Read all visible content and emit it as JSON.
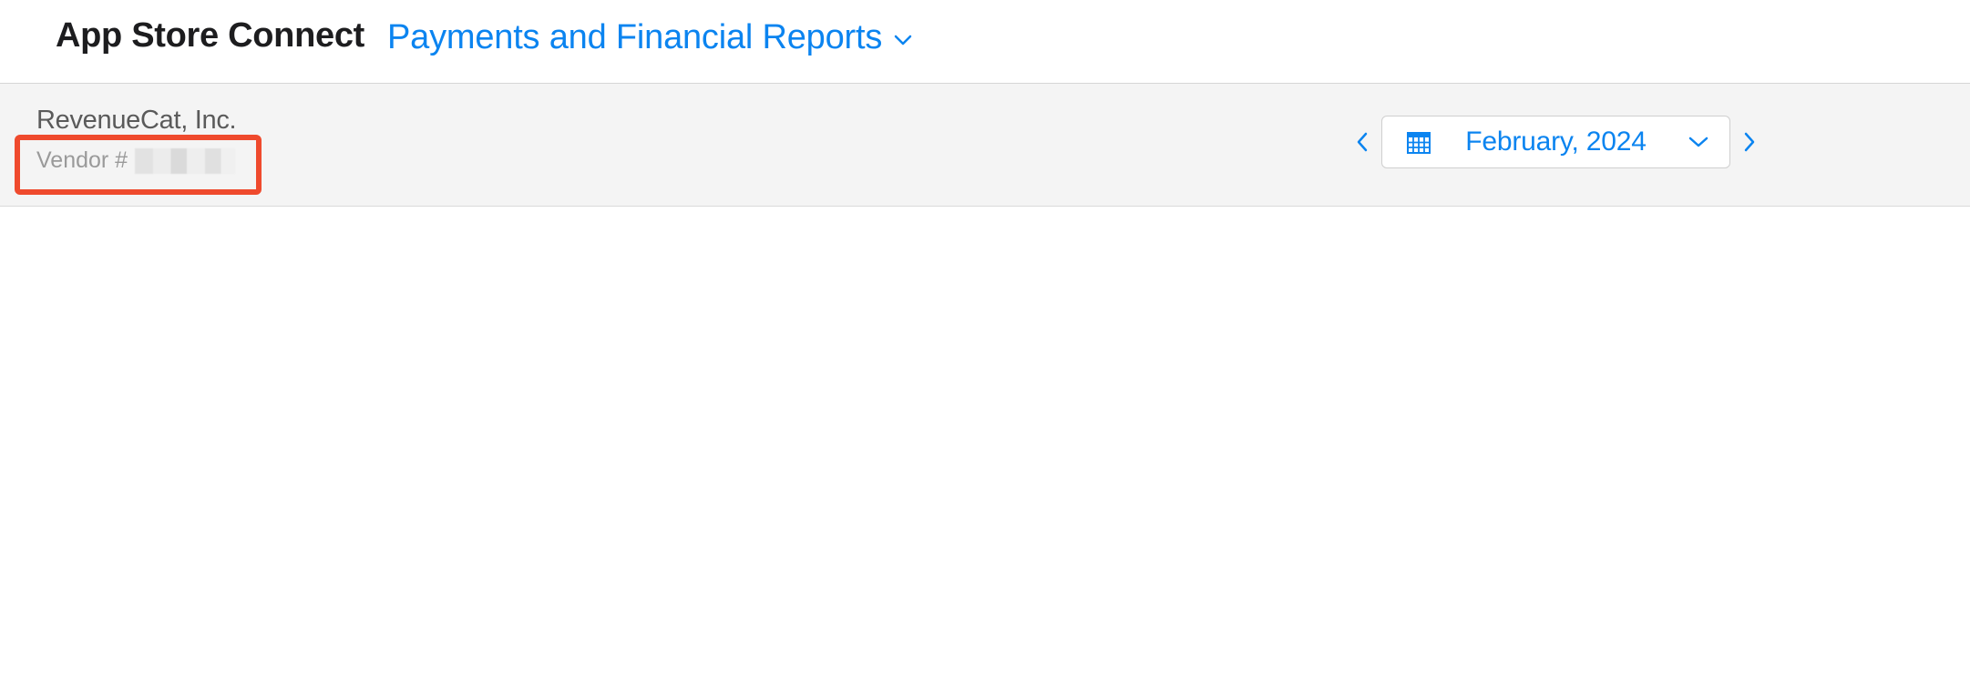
{
  "header": {
    "brand": "App Store Connect",
    "section": "Payments and Financial Reports",
    "section_icon": "chevron-down-icon"
  },
  "account": {
    "org_name": "RevenueCat, Inc.",
    "vendor_label": "Vendor #"
  },
  "period": {
    "selected": "February, 2024",
    "icons": {
      "prev": "chevron-left-icon",
      "next": "chevron-right-icon",
      "calendar": "calendar-icon",
      "dropdown": "chevron-down-icon"
    }
  },
  "colors": {
    "accent": "#0b84f0",
    "highlight": "#ef4a2d",
    "subbar_bg": "#f4f4f4"
  }
}
